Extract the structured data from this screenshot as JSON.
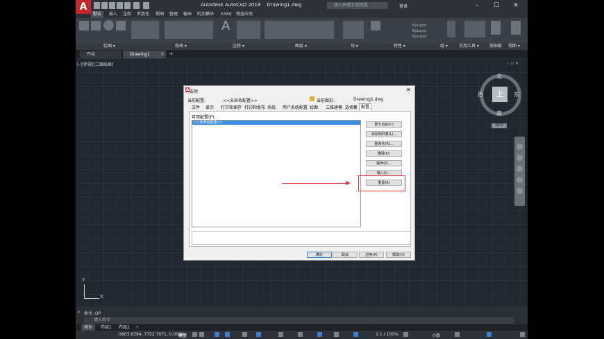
{
  "app": {
    "title": "Autodesk AutoCAD 2018",
    "document": "Drawing1.dwg",
    "logo": "A",
    "search_placeholder": "键入关键字或短语",
    "login": "登录"
  },
  "ribbon_tabs": [
    "默认",
    "插入",
    "注释",
    "参数化",
    "视图",
    "管理",
    "输出",
    "附加模块",
    "A360",
    "精选应用"
  ],
  "ribbon_panels": [
    "绘图 ▾",
    "修改 ▾",
    "注释 ▾",
    "图层 ▾",
    "块 ▾",
    "特性 ▾",
    "组 ▾",
    "实用工具 ▾",
    "剪贴板",
    "视图 ▾"
  ],
  "ribbon_labels": {
    "bylayer1": "ByLayer",
    "bylayer2": "ByLayer",
    "bylayer3": "ByLayer"
  },
  "file_tabs": [
    "开始",
    "Drawing1"
  ],
  "viewport_label": "[-][俯视][二维线框]",
  "viewcube": {
    "north": "北",
    "south": "南",
    "east": "东",
    "west": "西",
    "face": "上",
    "wcs": "WCS"
  },
  "ucs": {
    "x": "X",
    "y": "Y"
  },
  "command": {
    "history": "命令: OP",
    "placeholder": "键入命令"
  },
  "layout_tabs": [
    "模型",
    "布局1",
    "布局2"
  ],
  "status": {
    "coords": "-3603.6394, 7752.7071, 0.0000",
    "model": "模型",
    "scale": "1:1 / 100%",
    "units": "小数"
  },
  "dialog": {
    "title": "选项",
    "current_profile_label": "当前配置:",
    "current_profile_value": "<<未命名配置>>",
    "current_drawing_label": "当前图形:",
    "current_drawing_value": "Drawing1.dwg",
    "tabs": [
      "文件",
      "显示",
      "打开和保存",
      "打印和发布",
      "系统",
      "用户系统配置",
      "绘图",
      "三维建模",
      "选择集",
      "配置"
    ],
    "available_profiles_label": "可用配置(P):",
    "profiles": [
      "<<未命名配置>>"
    ],
    "side_buttons": [
      "置为当前(C)",
      "添加到列表(L)...",
      "重命名(R)...",
      "删除(D)",
      "输出(E)...",
      "输入(I)...",
      "重置(R)"
    ],
    "bottom_buttons": [
      "确定",
      "取消",
      "应用(A)",
      "帮助(H)"
    ]
  }
}
